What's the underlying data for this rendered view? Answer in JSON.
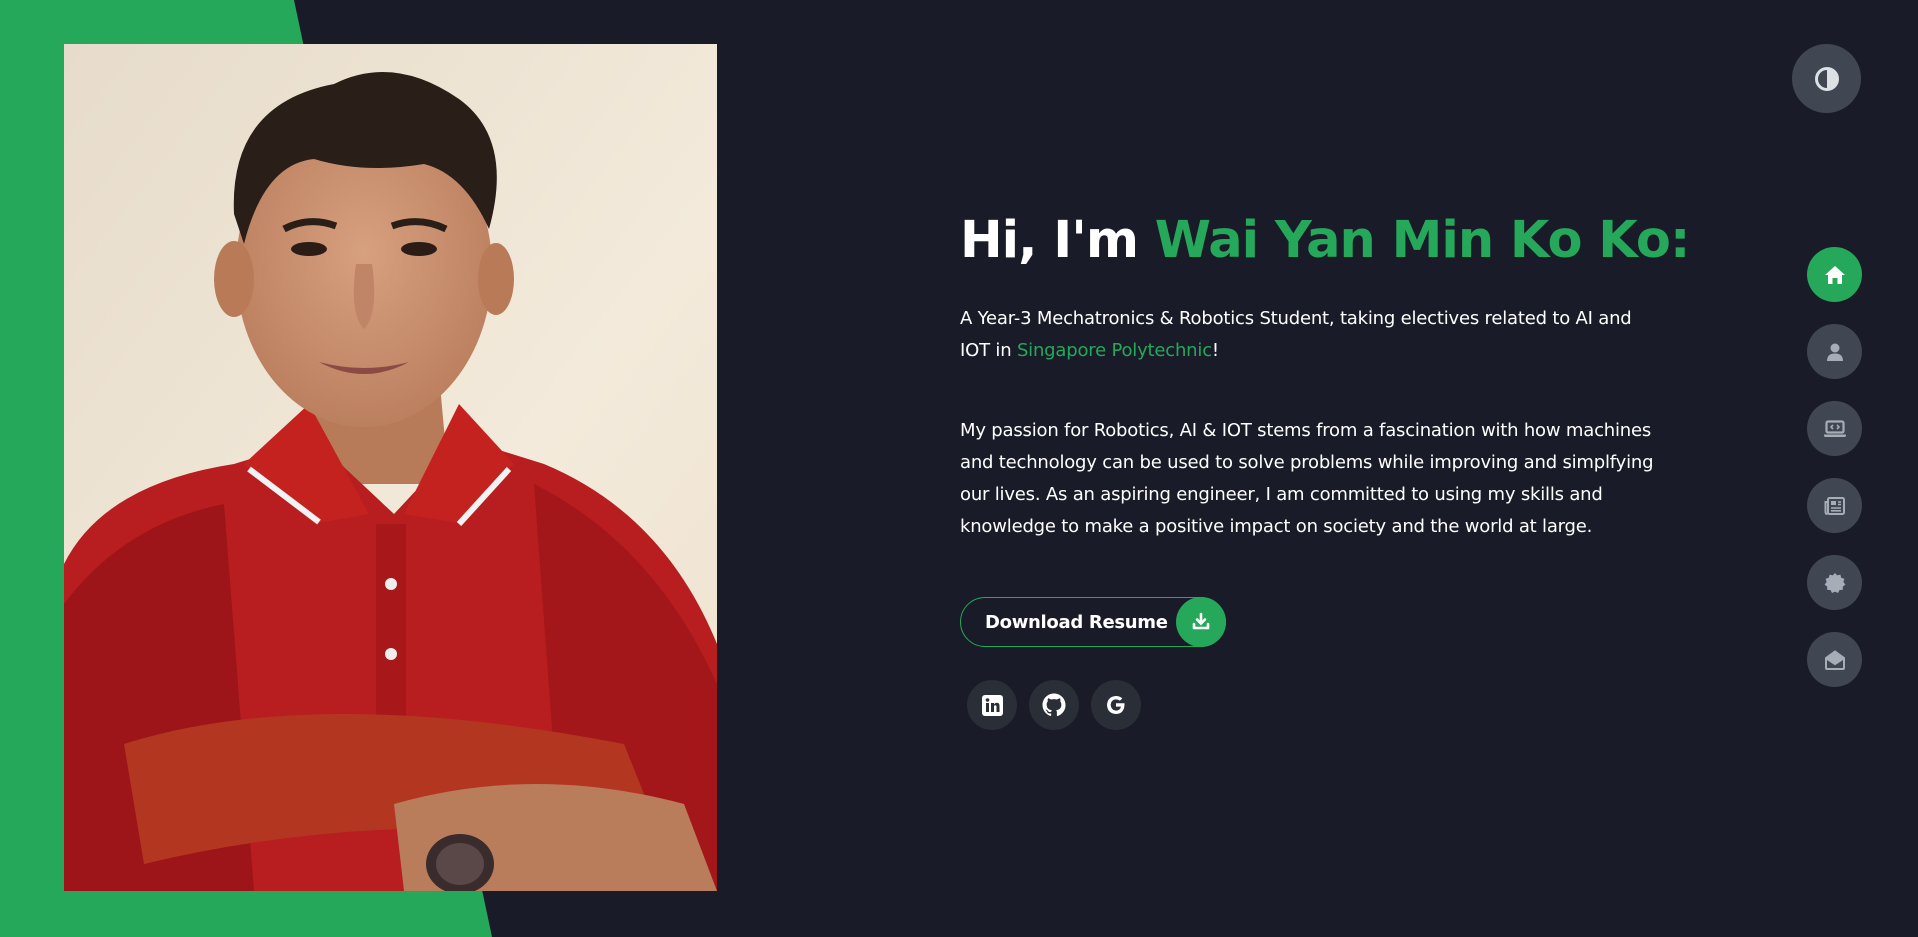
{
  "hero": {
    "greeting": "Hi, I'm ",
    "name": "Wai Yan Min Ko Ko:",
    "intro_before": "A Year-3 Mechatronics & Robotics Student, taking electives related to AI and IOT in ",
    "intro_school": "Singapore Polytechnic",
    "intro_after": "!",
    "passion": "My passion for Robotics, AI & IOT stems from a fascination with how machines and technology can be used to solve problems while improving and simplfying our lives. As an aspiring engineer, I am committed to using my skills and knowledge to make a positive impact on society and the world at large."
  },
  "resume_button": {
    "label": "Download Resume",
    "icon": "download-icon"
  },
  "social": [
    {
      "name": "linkedin",
      "icon": "linkedin-icon"
    },
    {
      "name": "github",
      "icon": "github-icon"
    },
    {
      "name": "google",
      "icon": "google-icon"
    }
  ],
  "nav": [
    {
      "name": "home",
      "icon": "home-icon",
      "active": true
    },
    {
      "name": "about",
      "icon": "user-icon",
      "active": false
    },
    {
      "name": "projects",
      "icon": "laptop-code-icon",
      "active": false
    },
    {
      "name": "articles",
      "icon": "newspaper-icon",
      "active": false
    },
    {
      "name": "certifications",
      "icon": "badge-icon",
      "active": false
    },
    {
      "name": "contact",
      "icon": "envelope-open-icon",
      "active": false
    }
  ],
  "theme_toggle": {
    "icon": "contrast-icon"
  },
  "colors": {
    "accent": "#25a85a",
    "background": "#191c28",
    "button_gray": "#404652",
    "social_bg": "#2a2e37"
  }
}
